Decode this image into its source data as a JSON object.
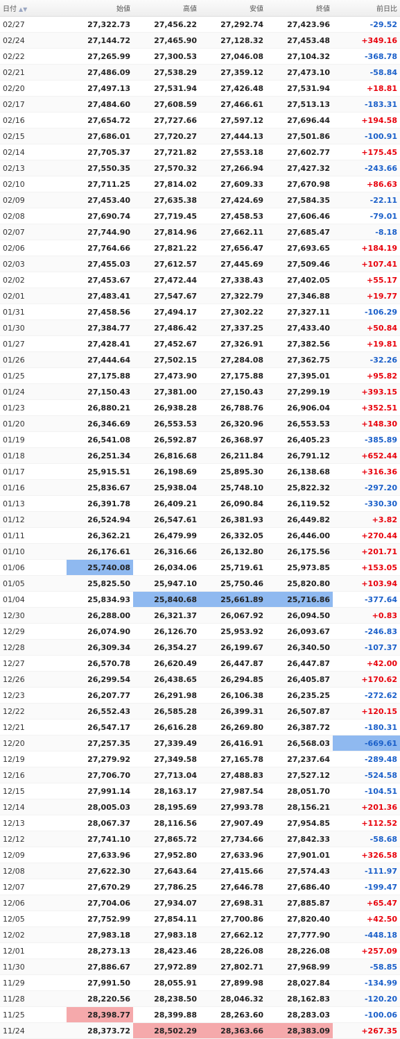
{
  "headers": {
    "date": "日付",
    "open": "始値",
    "high": "高値",
    "low": "安値",
    "close": "終値",
    "change": "前日比"
  },
  "icons": {
    "sort": "sort-up-down-icon"
  },
  "colors": {
    "up": "#e8000b",
    "down": "#1a5fc9",
    "highlight_low": "#8fb9f0",
    "highlight_high": "#f5a9ab"
  },
  "rows": [
    {
      "date": "02/27",
      "open": "27,322.73",
      "high": "27,456.22",
      "low": "27,292.74",
      "close": "27,423.96",
      "change": "-29.52"
    },
    {
      "date": "02/24",
      "open": "27,144.72",
      "high": "27,465.90",
      "low": "27,128.32",
      "close": "27,453.48",
      "change": "+349.16"
    },
    {
      "date": "02/22",
      "open": "27,265.99",
      "high": "27,300.53",
      "low": "27,046.08",
      "close": "27,104.32",
      "change": "-368.78"
    },
    {
      "date": "02/21",
      "open": "27,486.09",
      "high": "27,538.29",
      "low": "27,359.12",
      "close": "27,473.10",
      "change": "-58.84"
    },
    {
      "date": "02/20",
      "open": "27,497.13",
      "high": "27,531.94",
      "low": "27,426.48",
      "close": "27,531.94",
      "change": "+18.81"
    },
    {
      "date": "02/17",
      "open": "27,484.60",
      "high": "27,608.59",
      "low": "27,466.61",
      "close": "27,513.13",
      "change": "-183.31"
    },
    {
      "date": "02/16",
      "open": "27,654.72",
      "high": "27,727.66",
      "low": "27,597.12",
      "close": "27,696.44",
      "change": "+194.58"
    },
    {
      "date": "02/15",
      "open": "27,686.01",
      "high": "27,720.27",
      "low": "27,444.13",
      "close": "27,501.86",
      "change": "-100.91"
    },
    {
      "date": "02/14",
      "open": "27,705.37",
      "high": "27,721.82",
      "low": "27,553.18",
      "close": "27,602.77",
      "change": "+175.45"
    },
    {
      "date": "02/13",
      "open": "27,550.35",
      "high": "27,570.32",
      "low": "27,266.94",
      "close": "27,427.32",
      "change": "-243.66"
    },
    {
      "date": "02/10",
      "open": "27,711.25",
      "high": "27,814.02",
      "low": "27,609.33",
      "close": "27,670.98",
      "change": "+86.63"
    },
    {
      "date": "02/09",
      "open": "27,453.40",
      "high": "27,635.38",
      "low": "27,424.69",
      "close": "27,584.35",
      "change": "-22.11"
    },
    {
      "date": "02/08",
      "open": "27,690.74",
      "high": "27,719.45",
      "low": "27,458.53",
      "close": "27,606.46",
      "change": "-79.01"
    },
    {
      "date": "02/07",
      "open": "27,744.90",
      "high": "27,814.96",
      "low": "27,662.11",
      "close": "27,685.47",
      "change": "-8.18"
    },
    {
      "date": "02/06",
      "open": "27,764.66",
      "high": "27,821.22",
      "low": "27,656.47",
      "close": "27,693.65",
      "change": "+184.19"
    },
    {
      "date": "02/03",
      "open": "27,455.03",
      "high": "27,612.57",
      "low": "27,445.69",
      "close": "27,509.46",
      "change": "+107.41"
    },
    {
      "date": "02/02",
      "open": "27,453.67",
      "high": "27,472.44",
      "low": "27,338.43",
      "close": "27,402.05",
      "change": "+55.17"
    },
    {
      "date": "02/01",
      "open": "27,483.41",
      "high": "27,547.67",
      "low": "27,322.79",
      "close": "27,346.88",
      "change": "+19.77"
    },
    {
      "date": "01/31",
      "open": "27,458.56",
      "high": "27,494.17",
      "low": "27,302.22",
      "close": "27,327.11",
      "change": "-106.29"
    },
    {
      "date": "01/30",
      "open": "27,384.77",
      "high": "27,486.42",
      "low": "27,337.25",
      "close": "27,433.40",
      "change": "+50.84"
    },
    {
      "date": "01/27",
      "open": "27,428.41",
      "high": "27,452.67",
      "low": "27,326.91",
      "close": "27,382.56",
      "change": "+19.81"
    },
    {
      "date": "01/26",
      "open": "27,444.64",
      "high": "27,502.15",
      "low": "27,284.08",
      "close": "27,362.75",
      "change": "-32.26"
    },
    {
      "date": "01/25",
      "open": "27,175.88",
      "high": "27,473.90",
      "low": "27,175.88",
      "close": "27,395.01",
      "change": "+95.82"
    },
    {
      "date": "01/24",
      "open": "27,150.43",
      "high": "27,381.00",
      "low": "27,150.43",
      "close": "27,299.19",
      "change": "+393.15"
    },
    {
      "date": "01/23",
      "open": "26,880.21",
      "high": "26,938.28",
      "low": "26,788.76",
      "close": "26,906.04",
      "change": "+352.51"
    },
    {
      "date": "01/20",
      "open": "26,346.69",
      "high": "26,553.53",
      "low": "26,320.96",
      "close": "26,553.53",
      "change": "+148.30"
    },
    {
      "date": "01/19",
      "open": "26,541.08",
      "high": "26,592.87",
      "low": "26,368.97",
      "close": "26,405.23",
      "change": "-385.89"
    },
    {
      "date": "01/18",
      "open": "26,251.34",
      "high": "26,816.68",
      "low": "26,211.84",
      "close": "26,791.12",
      "change": "+652.44"
    },
    {
      "date": "01/17",
      "open": "25,915.51",
      "high": "26,198.69",
      "low": "25,895.30",
      "close": "26,138.68",
      "change": "+316.36"
    },
    {
      "date": "01/16",
      "open": "25,836.67",
      "high": "25,938.04",
      "low": "25,748.10",
      "close": "25,822.32",
      "change": "-297.20"
    },
    {
      "date": "01/13",
      "open": "26,391.78",
      "high": "26,409.21",
      "low": "26,090.84",
      "close": "26,119.52",
      "change": "-330.30"
    },
    {
      "date": "01/12",
      "open": "26,524.94",
      "high": "26,547.61",
      "low": "26,381.93",
      "close": "26,449.82",
      "change": "+3.82"
    },
    {
      "date": "01/11",
      "open": "26,362.21",
      "high": "26,479.99",
      "low": "26,332.05",
      "close": "26,446.00",
      "change": "+270.44"
    },
    {
      "date": "01/10",
      "open": "26,176.61",
      "high": "26,316.66",
      "low": "26,132.80",
      "close": "26,175.56",
      "change": "+201.71"
    },
    {
      "date": "01/06",
      "open": "25,740.08",
      "high": "26,034.06",
      "low": "25,719.61",
      "close": "25,973.85",
      "change": "+153.05",
      "hl": {
        "open": "blue"
      }
    },
    {
      "date": "01/05",
      "open": "25,825.50",
      "high": "25,947.10",
      "low": "25,750.46",
      "close": "25,820.80",
      "change": "+103.94"
    },
    {
      "date": "01/04",
      "open": "25,834.93",
      "high": "25,840.68",
      "low": "25,661.89",
      "close": "25,716.86",
      "change": "-377.64",
      "hl": {
        "high": "blue",
        "low": "blue",
        "close": "blue"
      }
    },
    {
      "date": "12/30",
      "open": "26,288.00",
      "high": "26,321.37",
      "low": "26,067.92",
      "close": "26,094.50",
      "change": "+0.83"
    },
    {
      "date": "12/29",
      "open": "26,074.90",
      "high": "26,126.70",
      "low": "25,953.92",
      "close": "26,093.67",
      "change": "-246.83"
    },
    {
      "date": "12/28",
      "open": "26,309.34",
      "high": "26,354.27",
      "low": "26,199.67",
      "close": "26,340.50",
      "change": "-107.37"
    },
    {
      "date": "12/27",
      "open": "26,570.78",
      "high": "26,620.49",
      "low": "26,447.87",
      "close": "26,447.87",
      "change": "+42.00"
    },
    {
      "date": "12/26",
      "open": "26,299.54",
      "high": "26,438.65",
      "low": "26,294.85",
      "close": "26,405.87",
      "change": "+170.62"
    },
    {
      "date": "12/23",
      "open": "26,207.77",
      "high": "26,291.98",
      "low": "26,106.38",
      "close": "26,235.25",
      "change": "-272.62"
    },
    {
      "date": "12/22",
      "open": "26,552.43",
      "high": "26,585.28",
      "low": "26,399.31",
      "close": "26,507.87",
      "change": "+120.15"
    },
    {
      "date": "12/21",
      "open": "26,547.17",
      "high": "26,616.28",
      "low": "26,269.80",
      "close": "26,387.72",
      "change": "-180.31"
    },
    {
      "date": "12/20",
      "open": "27,257.35",
      "high": "27,339.49",
      "low": "26,416.91",
      "close": "26,568.03",
      "change": "-669.61",
      "hl": {
        "change": "blue"
      }
    },
    {
      "date": "12/19",
      "open": "27,279.92",
      "high": "27,349.58",
      "low": "27,165.78",
      "close": "27,237.64",
      "change": "-289.48"
    },
    {
      "date": "12/16",
      "open": "27,706.70",
      "high": "27,713.04",
      "low": "27,488.83",
      "close": "27,527.12",
      "change": "-524.58"
    },
    {
      "date": "12/15",
      "open": "27,991.14",
      "high": "28,163.17",
      "low": "27,987.54",
      "close": "28,051.70",
      "change": "-104.51"
    },
    {
      "date": "12/14",
      "open": "28,005.03",
      "high": "28,195.69",
      "low": "27,993.78",
      "close": "28,156.21",
      "change": "+201.36"
    },
    {
      "date": "12/13",
      "open": "28,067.37",
      "high": "28,116.56",
      "low": "27,907.49",
      "close": "27,954.85",
      "change": "+112.52"
    },
    {
      "date": "12/12",
      "open": "27,741.10",
      "high": "27,865.72",
      "low": "27,734.66",
      "close": "27,842.33",
      "change": "-58.68"
    },
    {
      "date": "12/09",
      "open": "27,633.96",
      "high": "27,952.80",
      "low": "27,633.96",
      "close": "27,901.01",
      "change": "+326.58"
    },
    {
      "date": "12/08",
      "open": "27,622.30",
      "high": "27,643.64",
      "low": "27,415.66",
      "close": "27,574.43",
      "change": "-111.97"
    },
    {
      "date": "12/07",
      "open": "27,670.29",
      "high": "27,786.25",
      "low": "27,646.78",
      "close": "27,686.40",
      "change": "-199.47"
    },
    {
      "date": "12/06",
      "open": "27,704.06",
      "high": "27,934.07",
      "low": "27,698.31",
      "close": "27,885.87",
      "change": "+65.47"
    },
    {
      "date": "12/05",
      "open": "27,752.99",
      "high": "27,854.11",
      "low": "27,700.86",
      "close": "27,820.40",
      "change": "+42.50"
    },
    {
      "date": "12/02",
      "open": "27,983.18",
      "high": "27,983.18",
      "low": "27,662.12",
      "close": "27,777.90",
      "change": "-448.18"
    },
    {
      "date": "12/01",
      "open": "28,273.13",
      "high": "28,423.46",
      "low": "28,226.08",
      "close": "28,226.08",
      "change": "+257.09"
    },
    {
      "date": "11/30",
      "open": "27,886.67",
      "high": "27,972.89",
      "low": "27,802.71",
      "close": "27,968.99",
      "change": "-58.85"
    },
    {
      "date": "11/29",
      "open": "27,991.50",
      "high": "28,055.91",
      "low": "27,899.98",
      "close": "28,027.84",
      "change": "-134.99"
    },
    {
      "date": "11/28",
      "open": "28,220.56",
      "high": "28,238.50",
      "low": "28,046.32",
      "close": "28,162.83",
      "change": "-120.20"
    },
    {
      "date": "11/25",
      "open": "28,398.77",
      "high": "28,399.88",
      "low": "28,263.60",
      "close": "28,283.03",
      "change": "-100.06",
      "hl": {
        "open": "red"
      }
    },
    {
      "date": "11/24",
      "open": "28,373.72",
      "high": "28,502.29",
      "low": "28,363.66",
      "close": "28,383.09",
      "change": "+267.35",
      "hl": {
        "high": "red",
        "low": "red",
        "close": "red"
      }
    }
  ]
}
